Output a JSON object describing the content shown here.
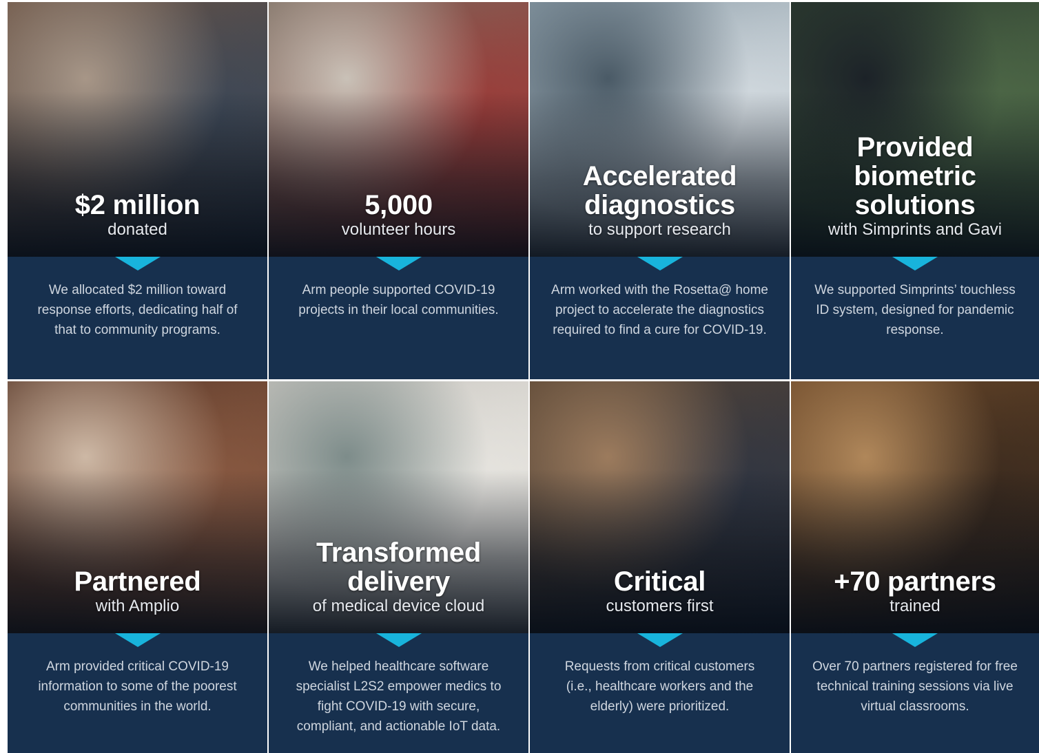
{
  "cards": [
    {
      "headline": "$2 million",
      "subline": "donated",
      "description": "We allocated $2 million toward response efforts, dedicating half of that to community programs.",
      "photo_colors": [
        "#6b5344",
        "#3c4756",
        "#a79687"
      ]
    },
    {
      "headline": "5,000",
      "subline": "volunteer hours",
      "description": "Arm people supported COVID-19 projects in their local communities.",
      "photo_colors": [
        "#7a6a5e",
        "#9b3b38",
        "#c9c1b7"
      ]
    },
    {
      "headline": "Accelerated diagnostics",
      "subline": "to support research",
      "description": "Arm worked with the Rosetta@ home project to accelerate the diagnostics required to find a cure for COVID-19.",
      "photo_colors": [
        "#8a9ba6",
        "#d6dde2",
        "#4a5a66"
      ]
    },
    {
      "headline": "Provided biometric solutions",
      "subline": "with Simprints and Gavi",
      "description": "We supported Simprints’ touchless ID system, designed for pandemic response.",
      "photo_colors": [
        "#2c3b2f",
        "#4f6a48",
        "#1c2228"
      ]
    },
    {
      "headline": "Partnered",
      "subline": "with Amplio",
      "description": "Arm provided critical COVID-19 information to some of the poorest communities in the world.",
      "photo_colors": [
        "#5b3a2a",
        "#8a5a42",
        "#cdb8a5"
      ]
    },
    {
      "headline": "Transformed delivery",
      "subline": "of medical device cloud",
      "description": "We helped healthcare software specialist L2S2 empower medics to fight COVID-19 with secure, compliant, and actionable IoT data.",
      "photo_colors": [
        "#c7c4be",
        "#e8e6e1",
        "#7d8c8a"
      ]
    },
    {
      "headline": "Critical",
      "subline": "customers first",
      "description": "Requests from critical customers (i.e., healthcare workers and the elderly) were prioritized.",
      "photo_colors": [
        "#5a4634",
        "#2f3542",
        "#9c7b5d"
      ]
    },
    {
      "headline": "+70 partners",
      "subline": "trained",
      "description": "Over 70 partners registered for free technical training sessions via live virtual classrooms.",
      "photo_colors": [
        "#6e4a2a",
        "#3a2a1e",
        "#b0875a"
      ]
    }
  ],
  "colors": {
    "panel": "#17304e",
    "pointer": "#18b4dc",
    "headline": "#ffffff",
    "description": "#cfd6df"
  }
}
